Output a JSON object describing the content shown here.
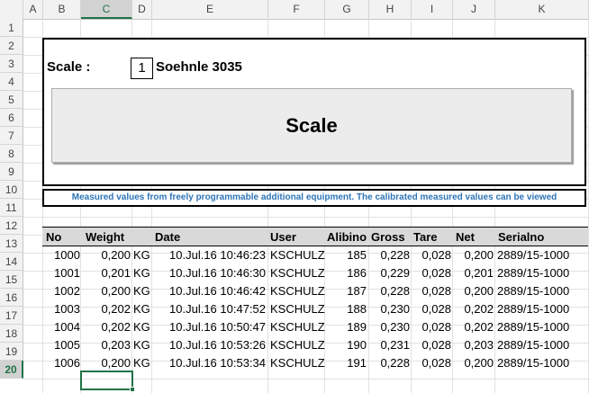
{
  "columns": [
    "A",
    "B",
    "C",
    "D",
    "E",
    "F",
    "G",
    "H",
    "I",
    "J",
    "K"
  ],
  "active_column": "C",
  "rows": [
    "1",
    "2",
    "3",
    "4",
    "5",
    "6",
    "7",
    "8",
    "9",
    "10",
    "11",
    "12",
    "13",
    "14",
    "15",
    "16",
    "17",
    "18",
    "19",
    "20"
  ],
  "active_row": "20",
  "panel": {
    "scale_label": "Scale :",
    "scale_number": "1",
    "scale_model": "Soehnle 3035",
    "button_label": "Scale",
    "info_text": "Measured values from freely programmable additional equipment. The calibrated measured values can be viewed"
  },
  "table": {
    "headers": [
      "No",
      "Weight",
      "Date",
      "User",
      "Alibino",
      "Gross",
      "Tare",
      "Net",
      "Serialno"
    ],
    "rows": [
      {
        "no": "1000",
        "weight": "0,200",
        "unit": "KG",
        "date": "10.Jul.16 10:46:23",
        "user": "KSCHULZ",
        "alibino": "185",
        "gross": "0,228",
        "tare": "0,028",
        "net": "0,200",
        "serial": "2889/15-1000"
      },
      {
        "no": "1001",
        "weight": "0,201",
        "unit": "KG",
        "date": "10.Jul.16 10:46:30",
        "user": "KSCHULZ",
        "alibino": "186",
        "gross": "0,229",
        "tare": "0,028",
        "net": "0,201",
        "serial": "2889/15-1000"
      },
      {
        "no": "1002",
        "weight": "0,200",
        "unit": "KG",
        "date": "10.Jul.16 10:46:42",
        "user": "KSCHULZ",
        "alibino": "187",
        "gross": "0,228",
        "tare": "0,028",
        "net": "0,200",
        "serial": "2889/15-1000"
      },
      {
        "no": "1003",
        "weight": "0,202",
        "unit": "KG",
        "date": "10.Jul.16 10:47:52",
        "user": "KSCHULZ",
        "alibino": "188",
        "gross": "0,230",
        "tare": "0,028",
        "net": "0,202",
        "serial": "2889/15-1000"
      },
      {
        "no": "1004",
        "weight": "0,202",
        "unit": "KG",
        "date": "10.Jul.16 10:50:47",
        "user": "KSCHULZ",
        "alibino": "189",
        "gross": "0,230",
        "tare": "0,028",
        "net": "0,202",
        "serial": "2889/15-1000"
      },
      {
        "no": "1005",
        "weight": "0,203",
        "unit": "KG",
        "date": "10.Jul.16 10:53:26",
        "user": "KSCHULZ",
        "alibino": "190",
        "gross": "0,231",
        "tare": "0,028",
        "net": "0,203",
        "serial": "2889/15-1000"
      },
      {
        "no": "1006",
        "weight": "0,200",
        "unit": "KG",
        "date": "10.Jul.16 10:53:34",
        "user": "KSCHULZ",
        "alibino": "191",
        "gross": "0,228",
        "tare": "0,028",
        "net": "0,200",
        "serial": "2889/15-1000"
      }
    ]
  },
  "colors": {
    "accent": "#217346",
    "info_text": "#2e75b6",
    "header_fill": "#d9d9d9"
  }
}
